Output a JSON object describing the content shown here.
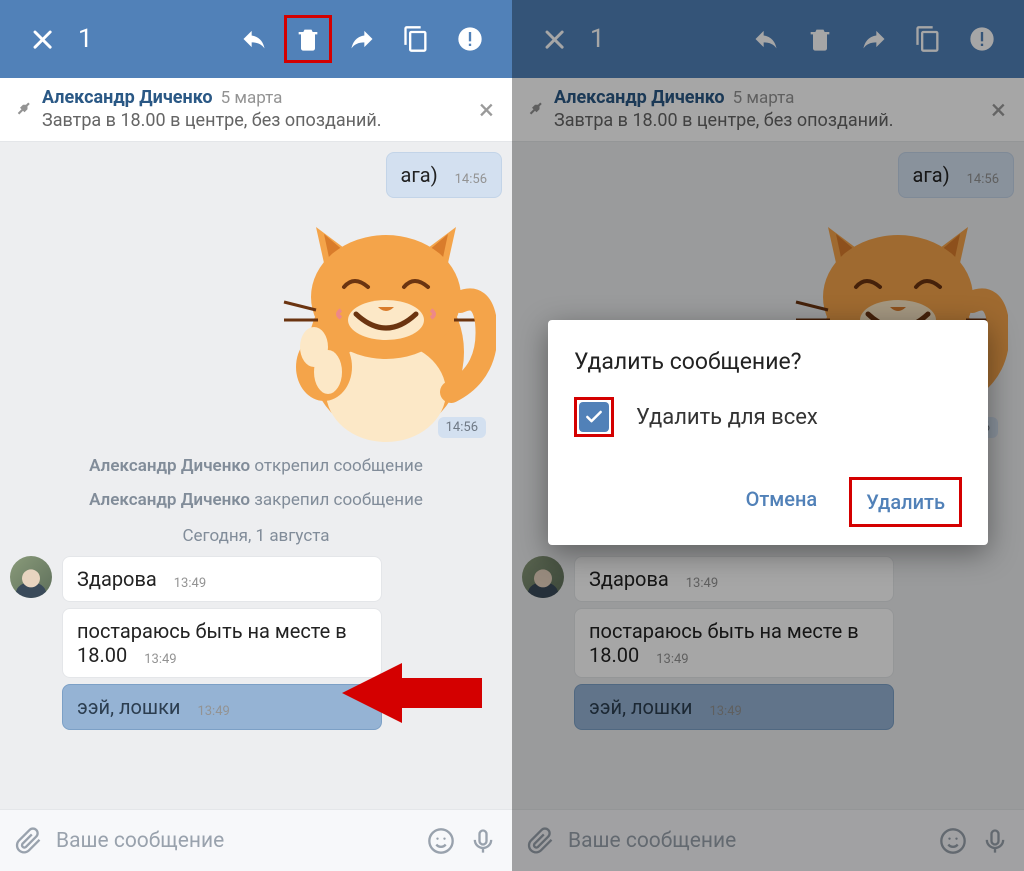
{
  "header": {
    "selected_count": "1",
    "icons": {
      "close": "close-icon",
      "reply": "reply-icon",
      "delete": "trash-icon",
      "forward": "forward-icon",
      "copy": "copy-icon",
      "report": "report-icon"
    }
  },
  "pinned": {
    "name": "Александр Диченко",
    "date": "5 марта",
    "text": "Завтра в 18.00 в центре, без опозданий."
  },
  "messages": {
    "aga": {
      "text": "ага)",
      "time": "14:56"
    },
    "sticker_time": "14:56",
    "sys1_name": "Александр Диченко",
    "sys1_action": " открепил сообщение",
    "sys2_name": "Александр Диченко",
    "sys2_action": " закрепил сообщение",
    "date_sep": "Сегодня, 1 августа",
    "in1": {
      "text": "Здарова",
      "time": "13:49"
    },
    "in2": {
      "text": "постараюсь быть на месте в 18.00",
      "time": "13:49"
    },
    "in3": {
      "text": "ээй, лошки",
      "time": "13:49"
    }
  },
  "composer": {
    "placeholder": "Ваше сообщение"
  },
  "dialog": {
    "title": "Удалить сообщение?",
    "checkbox_label": "Удалить для всех",
    "cancel": "Отмена",
    "confirm": "Удалить"
  }
}
